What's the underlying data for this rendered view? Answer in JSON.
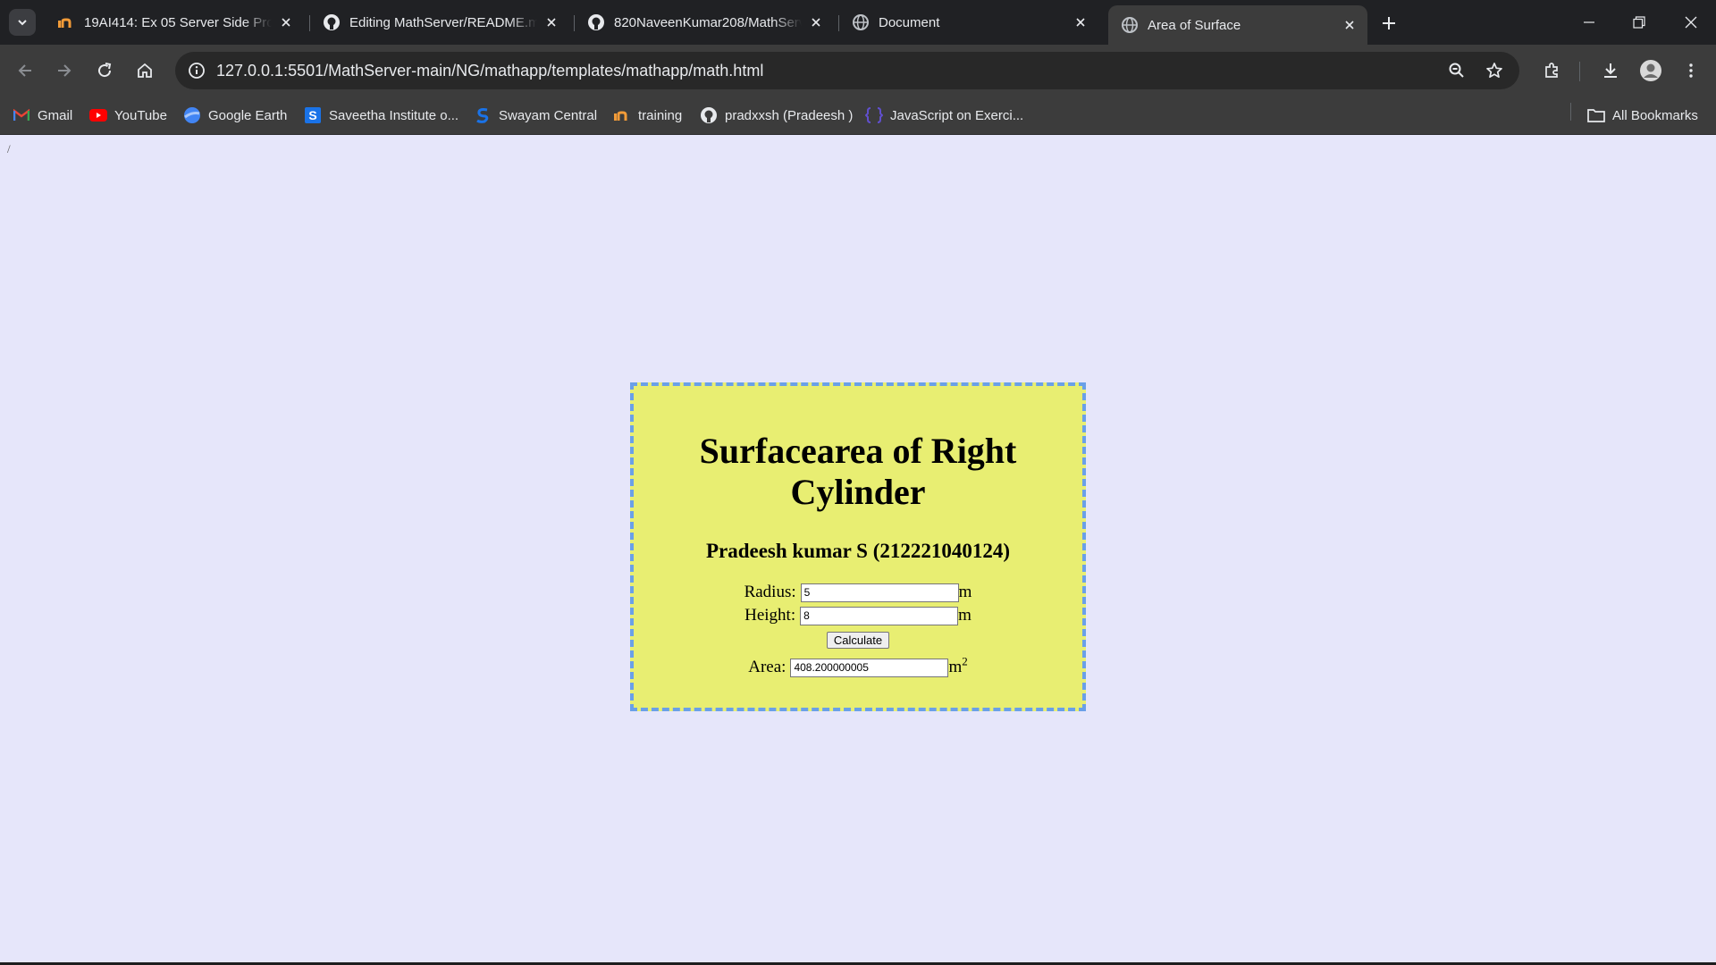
{
  "browser": {
    "tabs": [
      {
        "title": "19AI414: Ex 05 Server Side Proc",
        "icon": "in-logo-icon",
        "active": false
      },
      {
        "title": "Editing MathServer/README.md",
        "icon": "github-icon",
        "active": false
      },
      {
        "title": "820NaveenKumar208/MathServ",
        "icon": "github-icon",
        "active": false
      },
      {
        "title": "Document",
        "icon": "globe-icon",
        "active": false
      },
      {
        "title": "Area of Surface",
        "icon": "globe-icon",
        "active": true
      }
    ],
    "url": "127.0.0.1:5501/MathServer-main/NG/mathapp/templates/mathapp/math.html",
    "bookmarks": [
      {
        "label": "Gmail",
        "icon": "gmail-icon"
      },
      {
        "label": "YouTube",
        "icon": "youtube-icon"
      },
      {
        "label": "Google Earth",
        "icon": "google-earth-icon"
      },
      {
        "label": "Saveetha Institute o...",
        "icon": "saveetha-icon"
      },
      {
        "label": "Swayam Central",
        "icon": "swayam-icon"
      },
      {
        "label": "training",
        "icon": "in-logo-icon"
      },
      {
        "label": "pradxxsh (Pradeesh )",
        "icon": "github-icon"
      },
      {
        "label": "JavaScript on Exerci...",
        "icon": "exercism-icon"
      }
    ],
    "all_bookmarks": "All Bookmarks",
    "colors": {
      "chrome_dark": "#202124",
      "toolbar": "#3c3c3c",
      "page_bg": "#e6e6fa"
    }
  },
  "page": {
    "path_text": "/",
    "title": "Surfacearea of Right Cylinder",
    "author": "Pradeesh kumar S (212221040124)",
    "radius": {
      "label": "Radius:",
      "value": "5",
      "unit": "m"
    },
    "height": {
      "label": "Height:",
      "value": "8",
      "unit": "m"
    },
    "calculate_label": "Calculate",
    "area": {
      "label": "Area:",
      "value": "408.200000005",
      "unit": "m",
      "exponent": "2"
    },
    "colors": {
      "box_bg": "#e8ee72",
      "box_border": "#6aa0e8"
    }
  }
}
